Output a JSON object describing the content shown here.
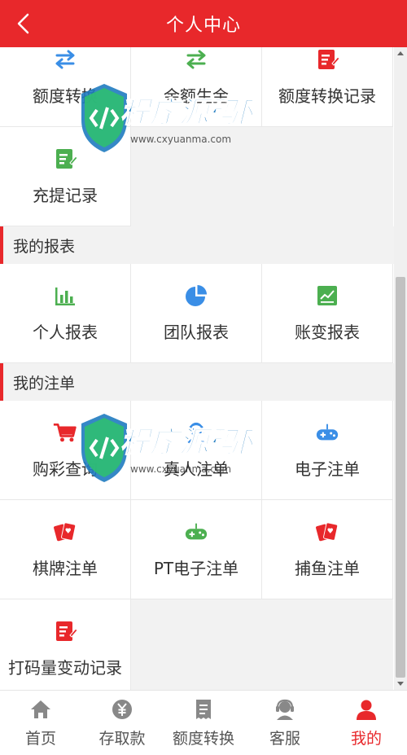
{
  "header": {
    "title": "个人中心"
  },
  "transfer_grid": {
    "items": [
      {
        "label": "额度转换",
        "icon": "swap-arrows-icon",
        "color": "#3a8ee6"
      },
      {
        "label": "余额生金",
        "icon": "swap-arrows-icon",
        "color": "#4caf50"
      },
      {
        "label": "额度转换记录",
        "icon": "edit-document-icon",
        "color": "#e8282b"
      },
      {
        "label": "充提记录",
        "icon": "edit-document-icon",
        "color": "#4caf50"
      }
    ]
  },
  "reports": {
    "section_title": "我的报表",
    "items": [
      {
        "label": "个人报表",
        "icon": "bar-chart-icon",
        "color": "#4caf50"
      },
      {
        "label": "团队报表",
        "icon": "pie-chart-icon",
        "color": "#3a8ee6"
      },
      {
        "label": "账变报表",
        "icon": "line-chart-icon",
        "color": "#4caf50"
      }
    ]
  },
  "bets": {
    "section_title": "我的注单",
    "items": [
      {
        "label": "购彩查询",
        "icon": "shopping-cart-icon",
        "color": "#e8282b"
      },
      {
        "label": "真人注单",
        "icon": "dealer-icon",
        "color": "#3a8ee6"
      },
      {
        "label": "电子注单",
        "icon": "gamepad-icon",
        "color": "#3a8ee6"
      },
      {
        "label": "棋牌注单",
        "icon": "playing-cards-icon",
        "color": "#e8282b"
      },
      {
        "label": "PT电子注单",
        "icon": "gamepad-icon",
        "color": "#4caf50"
      },
      {
        "label": "捕鱼注单",
        "icon": "playing-cards-icon",
        "color": "#e8282b"
      },
      {
        "label": "打码量变动记录",
        "icon": "edit-document-icon",
        "color": "#e8282b"
      }
    ]
  },
  "tabbar": {
    "tabs": [
      {
        "label": "首页",
        "icon": "home-icon"
      },
      {
        "label": "存取款",
        "icon": "yen-coin-icon"
      },
      {
        "label": "额度转换",
        "icon": "receipt-icon"
      },
      {
        "label": "客服",
        "icon": "headset-icon"
      },
      {
        "label": "我的",
        "icon": "user-icon",
        "active": true
      }
    ]
  },
  "watermark": {
    "brand": "程序源码网",
    "url": "www.cxyuanma.com"
  },
  "colors": {
    "primary": "#e8282b",
    "blue": "#3a8ee6",
    "green": "#4caf50"
  }
}
